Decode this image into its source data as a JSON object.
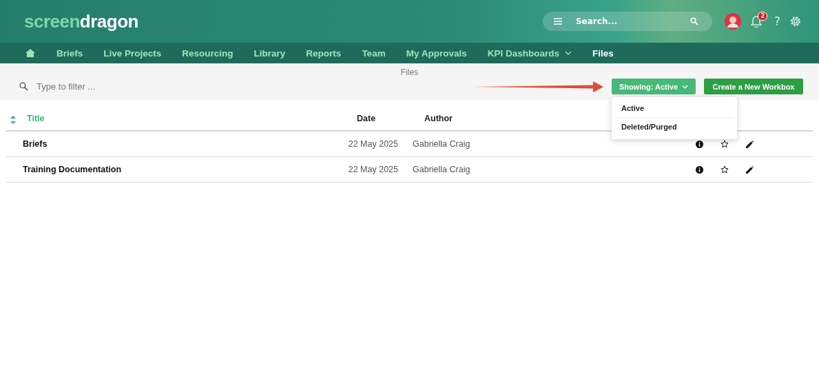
{
  "header": {
    "logo": {
      "part_1": "screen",
      "part_2": "dragon"
    },
    "search": {
      "placeholder": "Search..."
    },
    "notifications": {
      "count": "2"
    },
    "help": "?"
  },
  "nav": [
    {
      "label": "Briefs",
      "selected": false,
      "has_menu": false
    },
    {
      "label": "Live Projects",
      "selected": false,
      "has_menu": false
    },
    {
      "label": "Resourcing",
      "selected": false,
      "has_menu": false
    },
    {
      "label": "Library",
      "selected": false,
      "has_menu": false
    },
    {
      "label": "Reports",
      "selected": false,
      "has_menu": false
    },
    {
      "label": "Team",
      "selected": false,
      "has_menu": false
    },
    {
      "label": "My Approvals",
      "selected": false,
      "has_menu": false
    },
    {
      "label": "KPI Dashboards",
      "selected": false,
      "has_menu": true
    },
    {
      "label": "Files",
      "selected": true,
      "has_menu": false
    }
  ],
  "page_title": "Files",
  "filter": {
    "placeholder": "Type to filter ..."
  },
  "showing_button": "Showing: Active",
  "create_button": "Create a New Workbox",
  "showing_menu": [
    {
      "label": "Active"
    },
    {
      "label": "Deleted/Purged"
    }
  ],
  "table": {
    "columns": [
      "Title",
      "Date",
      "Author"
    ],
    "rows": [
      {
        "title": "Briefs",
        "date": "22 May 2025",
        "author": "Gabriella Craig"
      },
      {
        "title": "Training Documentation",
        "date": "22 May 2025",
        "author": "Gabriella Craig"
      }
    ]
  }
}
